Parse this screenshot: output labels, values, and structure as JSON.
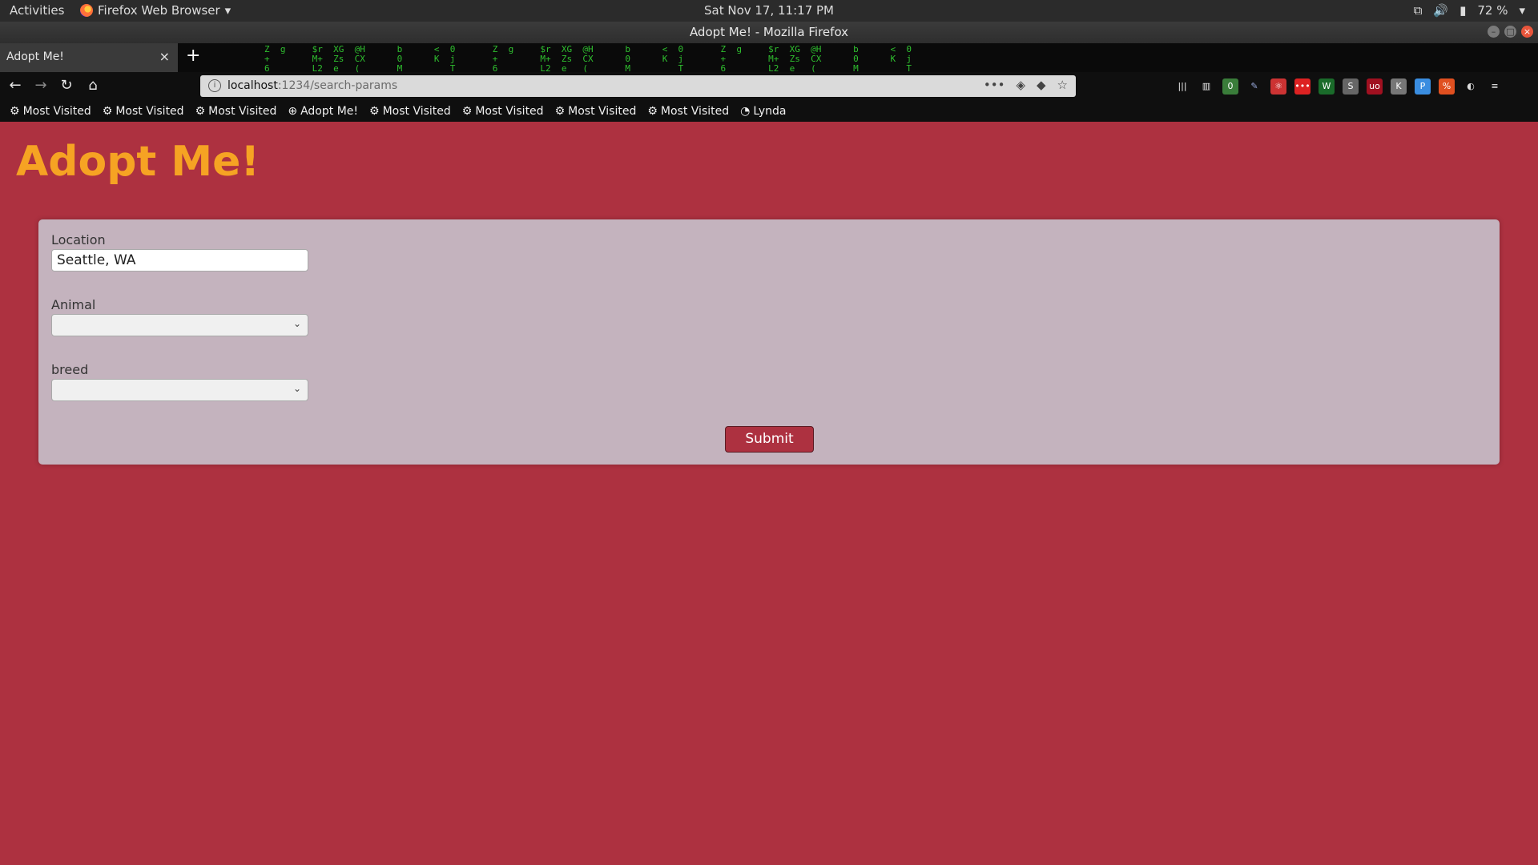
{
  "system_bar": {
    "activities": "Activities",
    "app_name": "Firefox Web Browser",
    "clock": "Sat Nov 17, 11:17 PM",
    "battery": "72 %"
  },
  "window": {
    "title": "Adopt Me! - Mozilla Firefox"
  },
  "tab": {
    "title": "Adopt Me!"
  },
  "urlbar": {
    "host": "localhost",
    "path": ":1234/search-params"
  },
  "bookmarks": [
    "Most Visited",
    "Most Visited",
    "Most Visited",
    "Adopt Me!",
    "Most Visited",
    "Most Visited",
    "Most Visited",
    "Most Visited",
    "Lynda"
  ],
  "page": {
    "title": "Adopt Me!",
    "location_label": "Location",
    "location_value": "Seattle, WA",
    "animal_label": "Animal",
    "animal_value": "",
    "breed_label": "breed",
    "breed_value": "",
    "submit_label": "Submit"
  },
  "colors": {
    "page_background": "#ad3140",
    "title_color": "#f6a323",
    "panel_background": "#c4b3be"
  }
}
